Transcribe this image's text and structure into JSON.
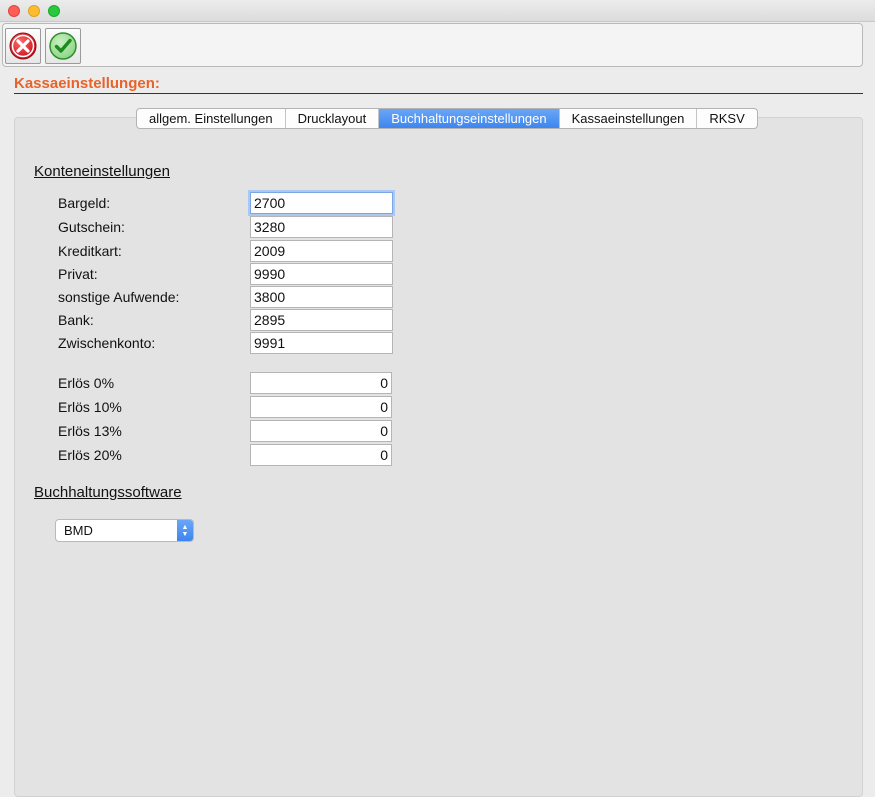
{
  "toolbar": {
    "cancel_icon": "cancel-icon",
    "ok_icon": "checkmark-icon"
  },
  "page": {
    "title": "Kassaeinstellungen:"
  },
  "tabs": [
    {
      "label": "allgem. Einstellungen",
      "active": false
    },
    {
      "label": "Drucklayout",
      "active": false
    },
    {
      "label": "Buchhaltungseinstellungen",
      "active": true
    },
    {
      "label": "Kassaeinstellungen",
      "active": false
    },
    {
      "label": "RKSV",
      "active": false
    }
  ],
  "konten": {
    "heading": "Konteneinstellungen",
    "fields": [
      {
        "label": "Bargeld:",
        "value": "2700"
      },
      {
        "label": "Gutschein:",
        "value": "3280"
      },
      {
        "label": "Kreditkart:",
        "value": "2009"
      },
      {
        "label": "Privat:",
        "value": "9990"
      },
      {
        "label": "sonstige Aufwende:",
        "value": "3800"
      },
      {
        "label": "Bank:",
        "value": "2895"
      },
      {
        "label": "Zwischenkonto:",
        "value": "9991"
      }
    ],
    "erloese": [
      {
        "label": "Erlös 0%",
        "value": "0"
      },
      {
        "label": "Erlös 10%",
        "value": "0"
      },
      {
        "label": "Erlös 13%",
        "value": "0"
      },
      {
        "label": "Erlös 20%",
        "value": "0"
      }
    ]
  },
  "software": {
    "heading": "Buchhaltungssoftware",
    "selected": "BMD"
  },
  "colors": {
    "accent_orange": "#e8632a",
    "tab_active": "#3d86ef"
  }
}
